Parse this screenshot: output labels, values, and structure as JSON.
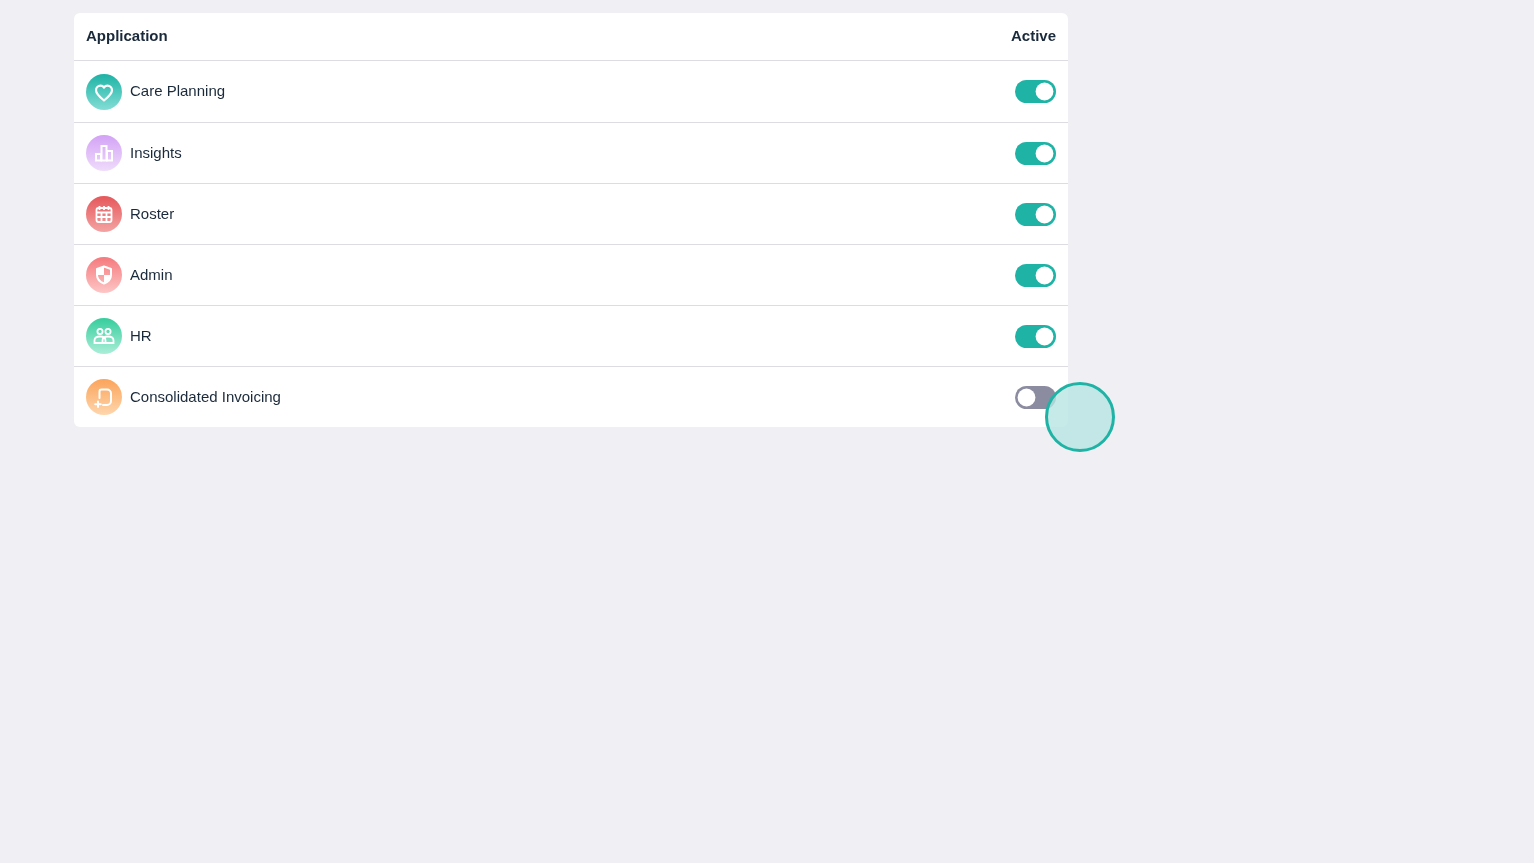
{
  "table": {
    "columns": [
      "Application",
      "Active"
    ],
    "rows": [
      {
        "name": "Care Planning",
        "active": true
      },
      {
        "name": "Insights",
        "active": true
      },
      {
        "name": "Roster",
        "active": true
      },
      {
        "name": "Admin",
        "active": true
      },
      {
        "name": "HR",
        "active": true
      },
      {
        "name": "Consolidated Invoicing",
        "active": false
      }
    ]
  }
}
